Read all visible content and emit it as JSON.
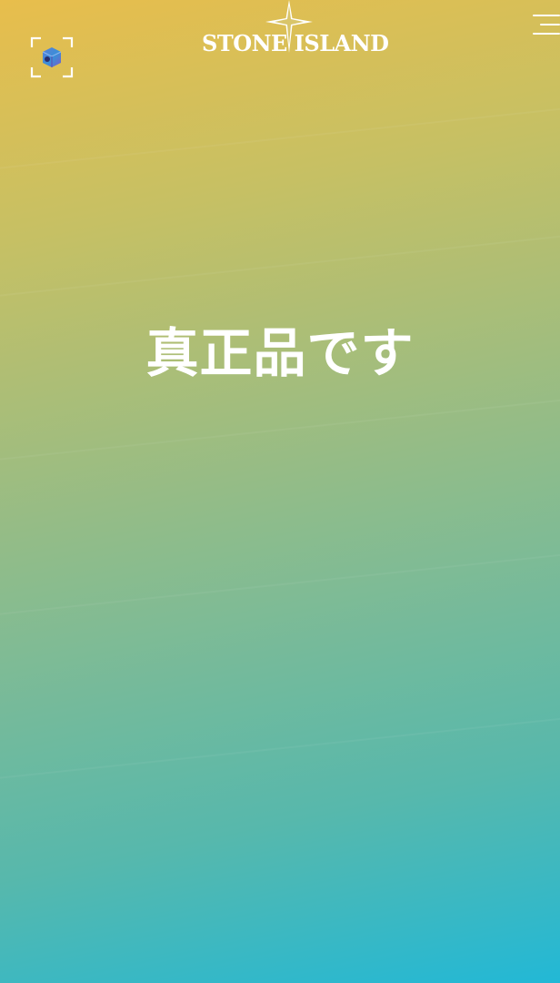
{
  "header": {
    "brand": "STONE ISLAND",
    "scan_icon": "scan-cube-icon",
    "menu_icon": "hamburger-menu-icon"
  },
  "main": {
    "result_text": "真正品です"
  },
  "colors": {
    "gradient_top": "#e8be4c",
    "gradient_bottom": "#22b8d6",
    "text": "#ffffff"
  }
}
